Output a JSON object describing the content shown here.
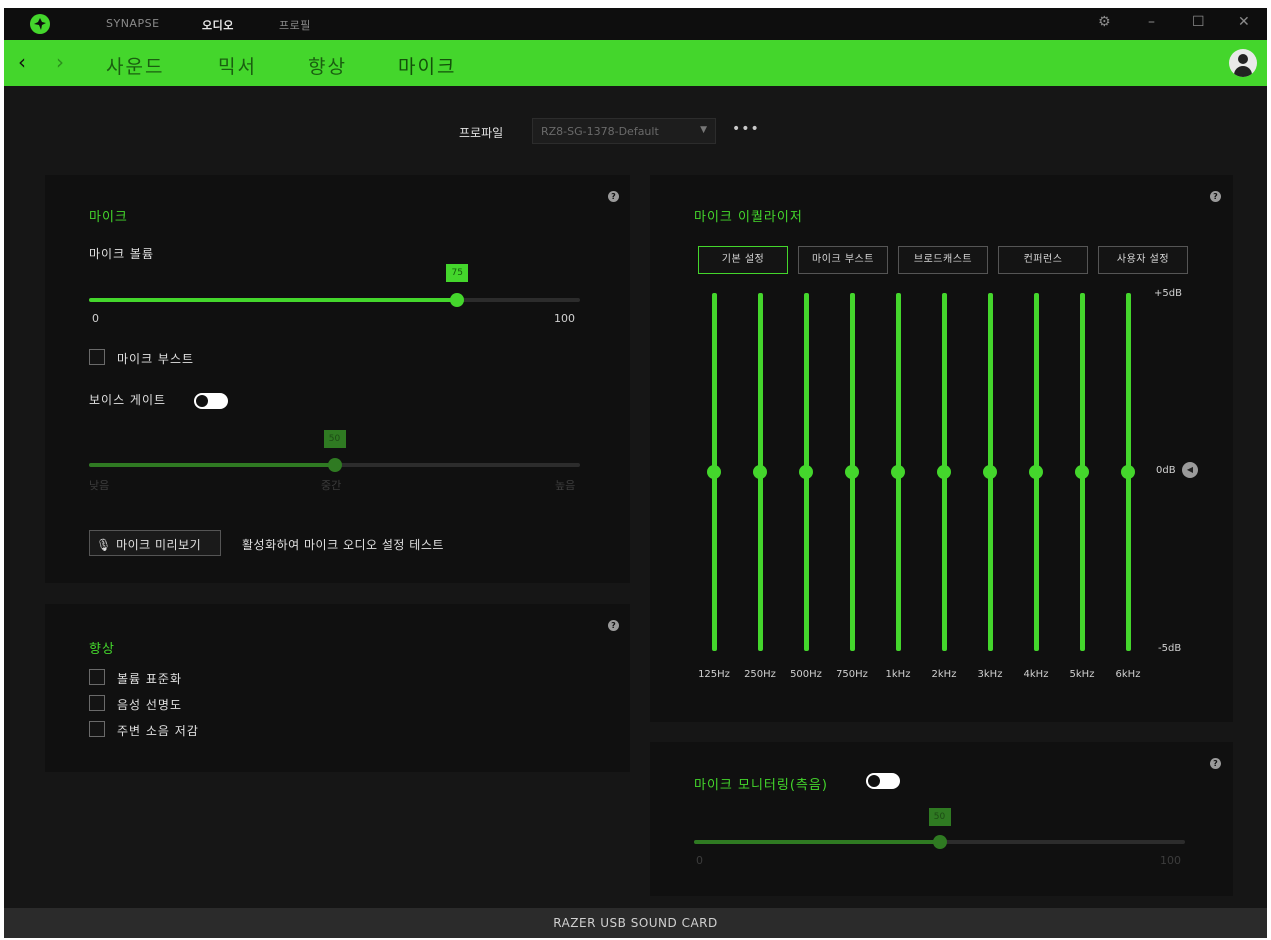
{
  "titlebar": {
    "nav": [
      "SYNAPSE",
      "오디오",
      "프로필"
    ],
    "active_nav": "오디오",
    "controls": [
      "⚙",
      "–",
      "☐",
      "✕"
    ]
  },
  "subnav": {
    "back": "‹",
    "forward": "›",
    "tabs": [
      "사운드",
      "믹서",
      "향상",
      "마이크"
    ],
    "active_tab": "마이크"
  },
  "profile": {
    "label": "프로파일",
    "selected": "RZ8-SG-1378-Default",
    "more": "•••"
  },
  "mic_panel": {
    "help": "?",
    "title": "마이크",
    "volume_label": "마이크 볼륨",
    "volume_value": "75",
    "volume_fraction": 0.75,
    "volume_min": "0",
    "volume_max": "100",
    "boost_label": "마이크 부스트",
    "boost_checked": false,
    "voice_gate_label": "보이스 게이트",
    "voice_gate_on": false,
    "gate_value": "50",
    "gate_fraction": 0.5,
    "gate_low": "낮음",
    "gate_mid": "중간",
    "gate_high": "높음",
    "preview_icon": "microphone-icon",
    "preview_button": "마이크 미리보기",
    "preview_hint": "활성화하여 마이크 오디오 설정 테스트"
  },
  "enhance_panel": {
    "help": "?",
    "title": "향상",
    "options": [
      {
        "label": "볼륨 표준화",
        "checked": false
      },
      {
        "label": "음성 선명도",
        "checked": false
      },
      {
        "label": "주변 소음 저감",
        "checked": false
      }
    ]
  },
  "eq_panel": {
    "help": "?",
    "title": "마이크 이퀄라이저",
    "presets": [
      "기본 설정",
      "마이크 부스트",
      "브로드캐스트",
      "컨퍼런스",
      "사용자 설정"
    ],
    "active_preset": "기본 설정",
    "db_top": "+5dB",
    "db_mid": "0dB",
    "db_bottom": "-5dB",
    "bands": [
      "125Hz",
      "250Hz",
      "500Hz",
      "750Hz",
      "1kHz",
      "2kHz",
      "3kHz",
      "4kHz",
      "5kHz",
      "6kHz"
    ],
    "band_gains_db": [
      0,
      0,
      0,
      0,
      0,
      0,
      0,
      0,
      0,
      0
    ]
  },
  "monitor_panel": {
    "help": "?",
    "title": "마이크 모니터링(측음)",
    "toggle_on": false,
    "value": "50",
    "fraction": 0.5,
    "min": "0",
    "max": "100"
  },
  "footer": {
    "device": "RAZER USB SOUND CARD"
  },
  "colors": {
    "accent": "#44d62c",
    "background": "#161616",
    "panel": "#101010"
  }
}
